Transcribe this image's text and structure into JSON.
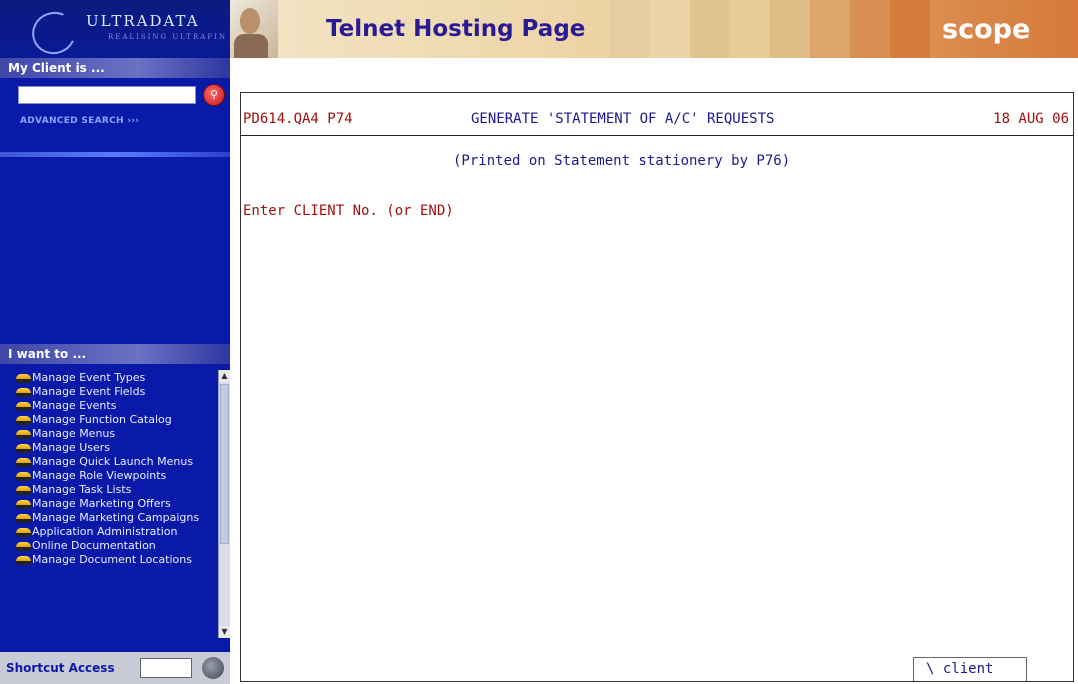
{
  "sidebar": {
    "logo": {
      "brand": "ULTRADATA",
      "tagline": "REALISING ULTRAFIN"
    },
    "client_section": {
      "heading": "My Client is ...",
      "search_value": "",
      "advanced_search": "ADVANCED SEARCH ›››"
    },
    "want_section": {
      "heading": "I want to ..."
    },
    "menu_items": [
      "Manage Event Types",
      "Manage Event Fields",
      "Manage Events",
      "Manage Function Catalog",
      "Manage Menus",
      "Manage Users",
      "Manage Quick Launch Menus",
      "Manage Role Viewpoints",
      "Manage Task Lists",
      "Manage Marketing Offers",
      "Manage Marketing Campaigns",
      "Application Administration",
      "Online Documentation",
      "Manage Document Locations"
    ],
    "shortcut": {
      "label": "Shortcut Access",
      "value": ""
    }
  },
  "header": {
    "title": "Telnet Hosting Page",
    "brand": "scope"
  },
  "terminal": {
    "program": "PD614.QA4 P74",
    "title": "GENERATE 'STATEMENT OF A/C' REQUESTS",
    "date": "18 AUG 06",
    "note": "(Printed on Statement stationery by P76)",
    "prompt": "Enter CLIENT No. (or END)",
    "client_button": "\\  client"
  },
  "colors": {
    "sidebar_bg": "#0a1aa8",
    "header_title": "#2a1b94",
    "terminal_red": "#a01010",
    "terminal_blue": "#1a1a8a"
  }
}
